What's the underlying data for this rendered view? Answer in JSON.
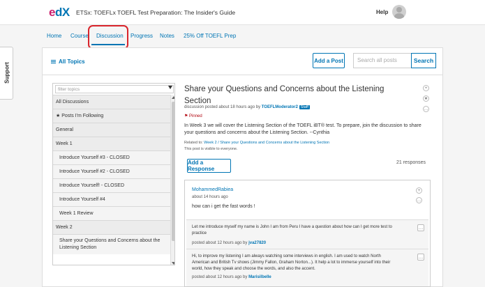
{
  "header": {
    "course_title": "ETSx: TOEFLx TOEFL Test Preparation: The Insider's Guide",
    "help": "Help",
    "logo_e": "e",
    "logo_dx": "dX"
  },
  "tabs": [
    {
      "label": "Home"
    },
    {
      "label": "Course"
    },
    {
      "label": "Discussion"
    },
    {
      "label": "Progress"
    },
    {
      "label": "Notes"
    },
    {
      "label": "25% Off TOEFL Prep"
    }
  ],
  "support": "Support",
  "toolbar": {
    "all_topics": "All Topics",
    "add_post": "Add a Post",
    "search_placeholder": "Search all posts",
    "search_button": "Search"
  },
  "sidebar": {
    "filter_placeholder": "filter topics",
    "topics": [
      {
        "label": "All Discussions"
      },
      {
        "label": "★ Posts I'm Following"
      },
      {
        "label": "General"
      },
      {
        "label": "Week 1"
      },
      {
        "label": "Introduce Yourself #3 - CLOSED"
      },
      {
        "label": "Introduce Yourself #2 - CLOSED"
      },
      {
        "label": "Introduce Yourself! - CLOSED"
      },
      {
        "label": "Introduce Yourself #4"
      },
      {
        "label": "Week 1 Review"
      },
      {
        "label": "Week 2"
      },
      {
        "label": "Share your Questions and Concerns about the Listening Section"
      }
    ]
  },
  "thread": {
    "title": "Share your Questions and Concerns about the Listening Section",
    "meta_prefix": "discussion posted about 18 hours ago by ",
    "author": "TOEFLModerator2",
    "staff": "Staff",
    "pinned": "⚑ Pinned",
    "body": "In Week 3 we will cover the Listening Section of the TOEFL iBT® test. To prepare, join the discussion to share your questions and concerns about the Listening Section. --Cynthia",
    "related_prefix": "Related to: ",
    "related_link": "Week 2 / Share your Questions and Concerns about the Listening Section",
    "visibility": "This post is visible to everyone.",
    "add_response": "Add a Response",
    "responses_count": "21 responses"
  },
  "response": {
    "author": "MohammedRabiea",
    "time": "about 14 hours ago",
    "body": "how can i get the fast words !",
    "comments": [
      {
        "text": "Let me introduce myself my name is John I am from Peru I have a question about how can I get more test to practice",
        "meta_prefix": "posted about 12 hours ago by ",
        "author": "jva27820"
      },
      {
        "text": "Hi, to improve my listening I am always watching some interviews in english. I am used to watch North American and British Tv shows (Jimmy Fallon, Graham Norton...). It help a lot to immerse yourself into their world, how they speak and choose the words, and also the accent.",
        "meta_prefix": "posted about 12 hours ago by ",
        "author": "Marisilbelle"
      }
    ]
  },
  "colors": {
    "accent": "#0075b4",
    "highlight": "#d9242b",
    "pinned": "#b20610"
  }
}
